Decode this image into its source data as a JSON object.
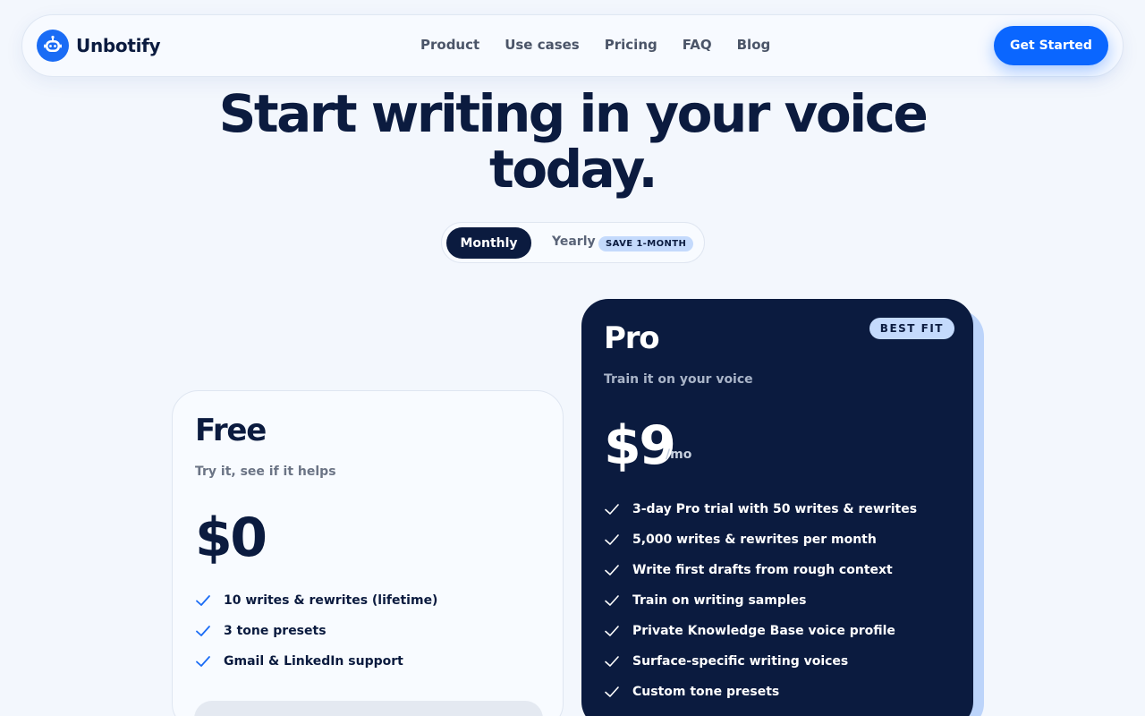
{
  "brand": {
    "name": "Unbotify",
    "icon": "robot-icon"
  },
  "nav": {
    "links": [
      "Product",
      "Use cases",
      "Pricing",
      "FAQ",
      "Blog"
    ],
    "cta_label": "Get Started"
  },
  "hero": {
    "title_line1": "Start writing in your voice",
    "title_line2": "today."
  },
  "billing_toggle": {
    "monthly_label": "Monthly",
    "yearly_label": "Yearly",
    "yearly_badge": "SAVE 1-MONTH",
    "selected": "Monthly"
  },
  "plans": {
    "free": {
      "name": "Free",
      "subtitle": "Try it, see if it helps",
      "price": "$0",
      "features": [
        "10 writes & rewrites (lifetime)",
        "3 tone presets",
        "Gmail & LinkedIn support"
      ]
    },
    "pro": {
      "badge": "BEST FIT",
      "name": "Pro",
      "subtitle": "Train it on your voice",
      "price": "$9",
      "period": "/mo",
      "features": [
        "3-day Pro trial with 50 writes & rewrites",
        "5,000 writes & rewrites per month",
        "Write first drafts from rough context",
        "Train on writing samples",
        "Private Knowledge Base voice profile",
        "Surface-specific writing voices",
        "Custom tone presets"
      ]
    }
  },
  "colors": {
    "accent": "#0a66ff",
    "navy": "#0b1b3f",
    "badge_bg": "#c4dafc",
    "background": "#f3f7fd"
  }
}
